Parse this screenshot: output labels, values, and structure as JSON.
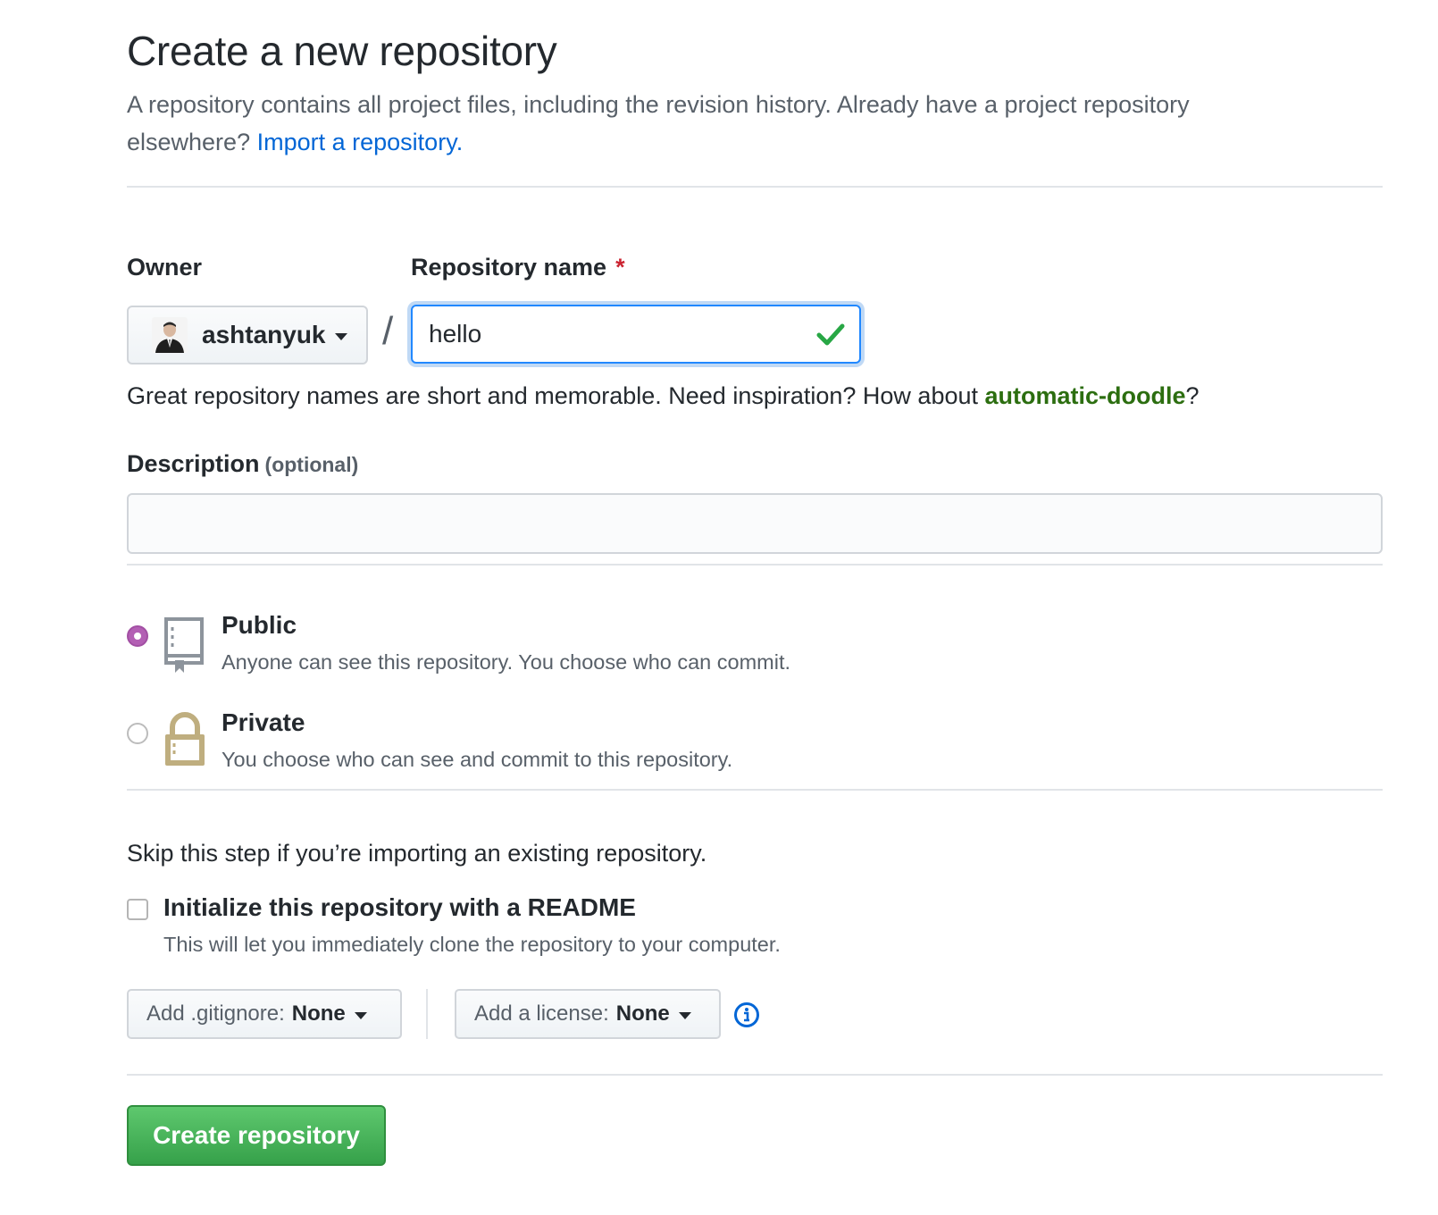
{
  "header": {
    "title": "Create a new repository",
    "subtitle_text": "A repository contains all project files, including the revision history. Already have a project repository elsewhere?",
    "import_link": "Import a repository."
  },
  "owner": {
    "label": "Owner",
    "selected": "ashtanyuk"
  },
  "repo_name": {
    "label": "Repository name",
    "required_mark": "*",
    "value": "hello",
    "valid_icon": "check-icon"
  },
  "separator": "/",
  "hint": {
    "text": "Great repository names are short and memorable. Need inspiration? How about",
    "suggestion": "automatic-doodle",
    "end": "?"
  },
  "description": {
    "label": "Description",
    "optional": "(optional)",
    "value": ""
  },
  "visibility": {
    "public": {
      "title": "Public",
      "desc": "Anyone can see this repository. You choose who can commit.",
      "icon": "repo-book-icon",
      "checked": true
    },
    "private": {
      "title": "Private",
      "desc": "You choose who can see and commit to this repository.",
      "icon": "lock-icon",
      "checked": false
    }
  },
  "init": {
    "skip_text": "Skip this step if you’re importing an existing repository.",
    "readme_title": "Initialize this repository with a README",
    "readme_desc": "This will let you immediately clone the repository to your computer.",
    "checked": false
  },
  "gitignore": {
    "label": "Add .gitignore:",
    "value": "None"
  },
  "license": {
    "label": "Add a license:",
    "value": "None"
  },
  "info_icon": "info-icon",
  "submit": {
    "label": "Create repository"
  },
  "colors": {
    "link": "#0366d6",
    "suggestion": "#2c6e10",
    "radio_checked": "#b35fb4",
    "primary_button": "#36a14a",
    "lock": "#bfae7f"
  }
}
